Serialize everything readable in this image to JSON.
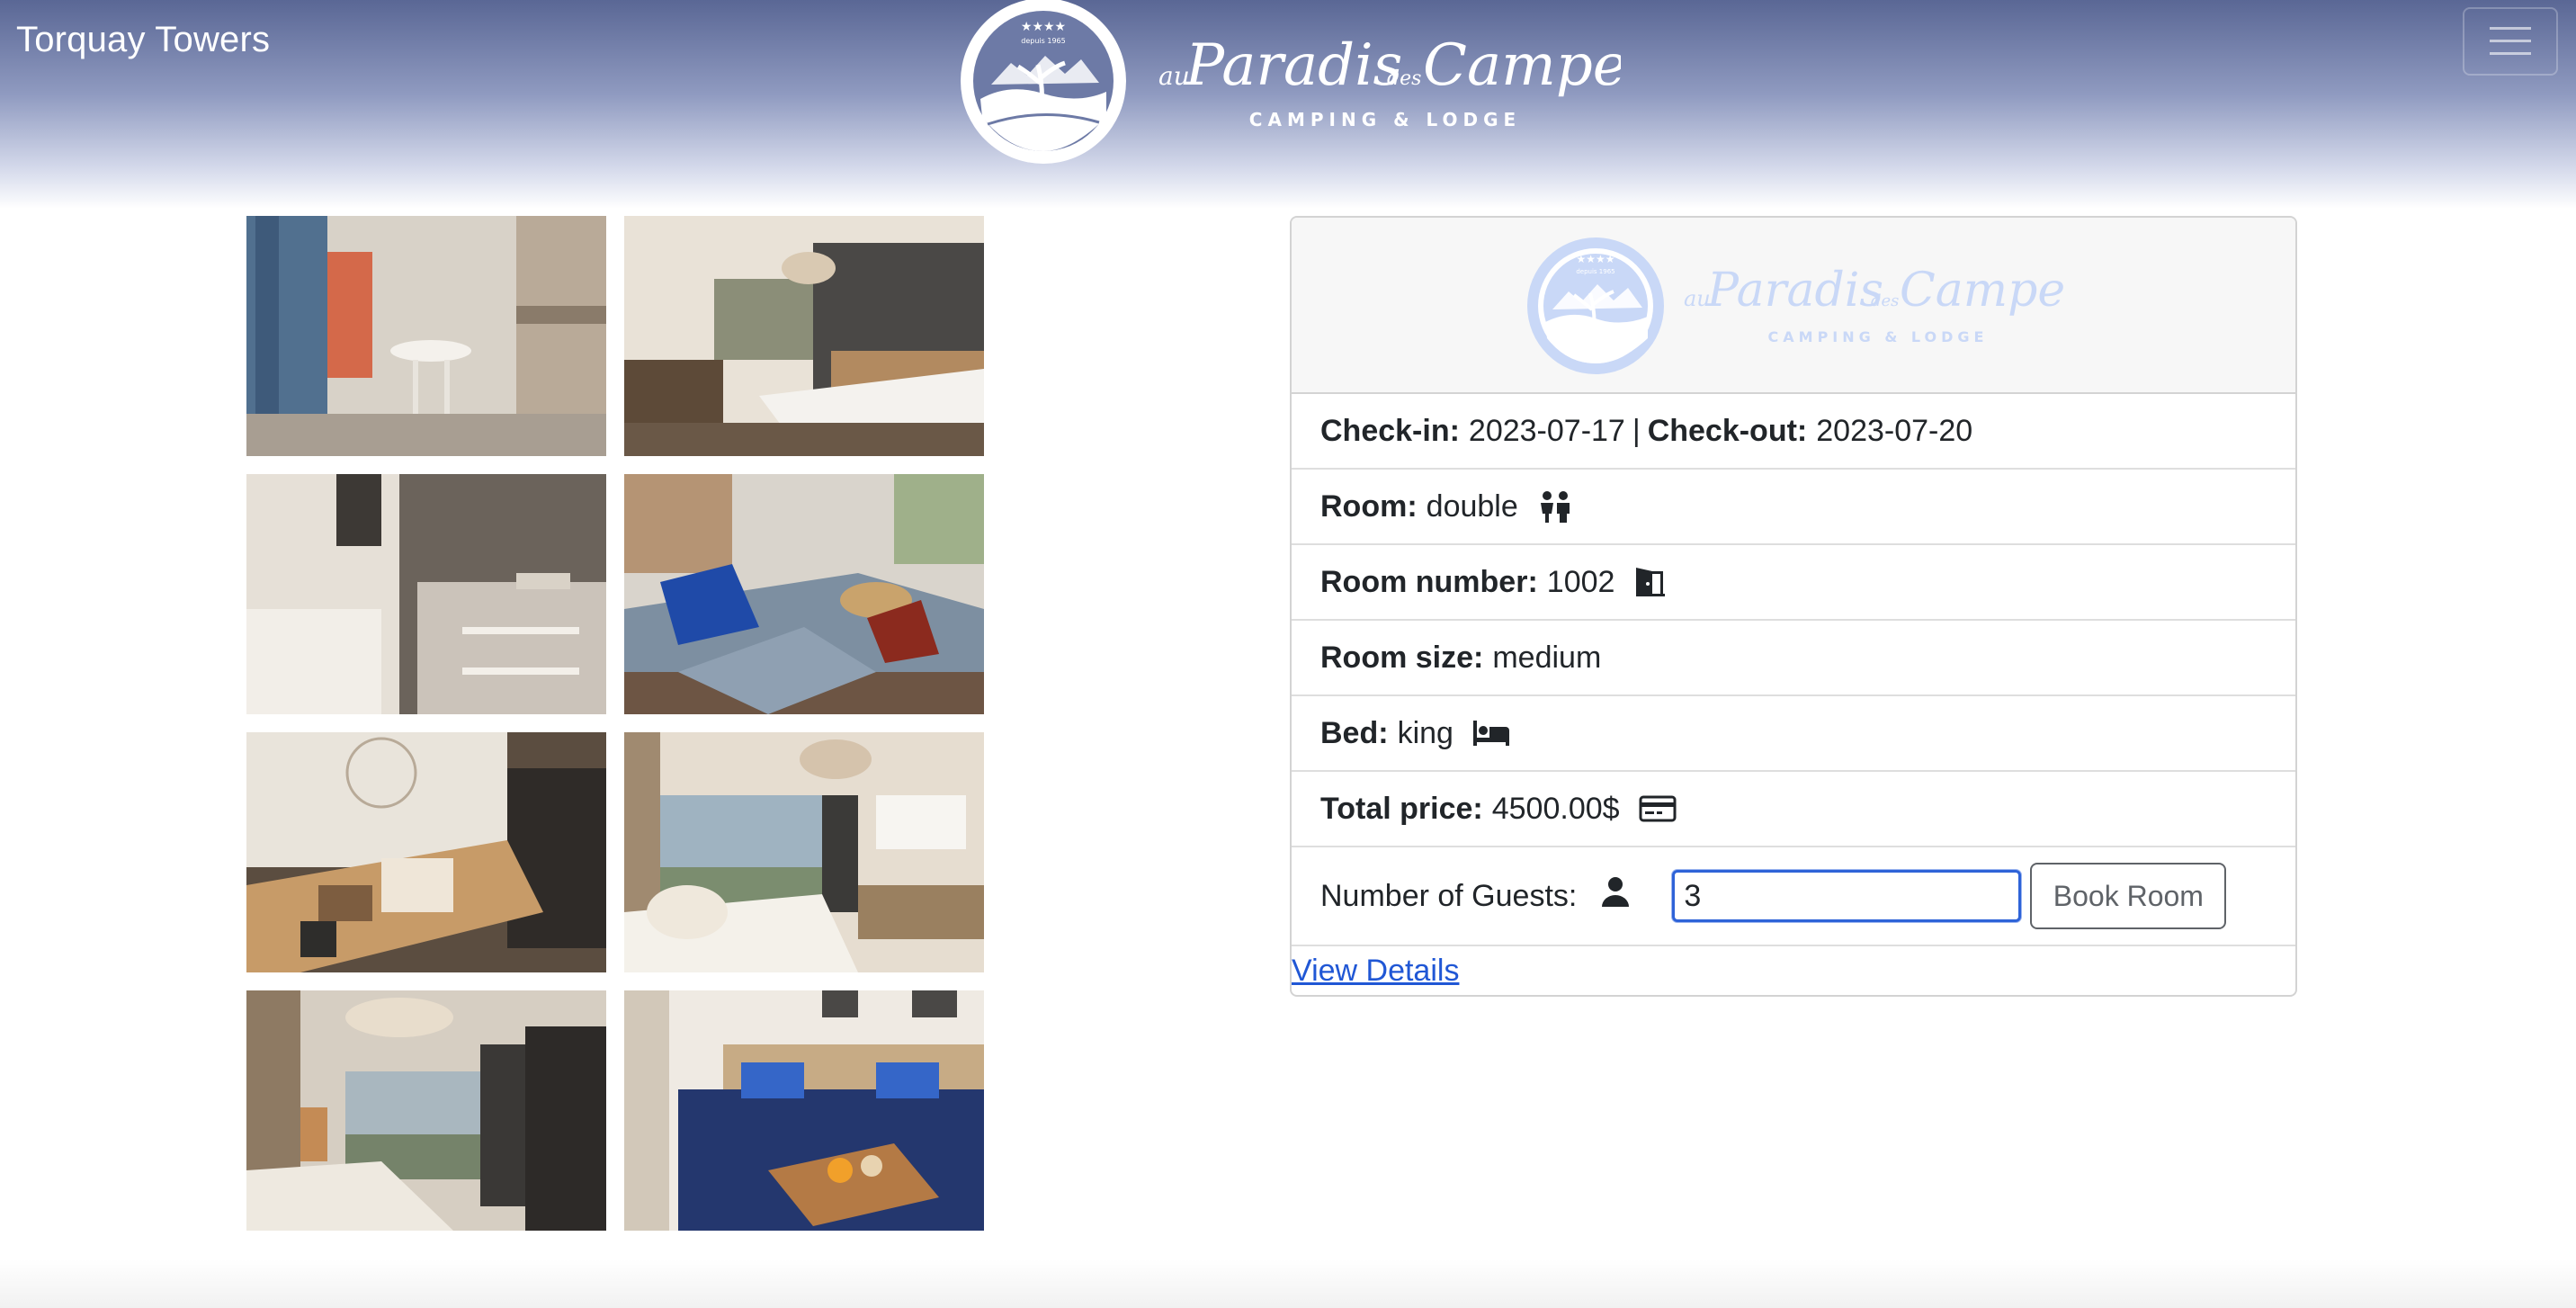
{
  "header": {
    "brand": "Torquay Towers",
    "logo": {
      "script_prefix": "au",
      "script_main": "Paradis",
      "script_small": "des",
      "script_end": "Campeurs",
      "tagline": "CAMPING & LODGE",
      "stars": "★★★★",
      "since": "depuis 1965"
    },
    "menu_icon": "hamburger-icon"
  },
  "gallery": {
    "photos": [
      {
        "alt": "room-photo-1"
      },
      {
        "alt": "room-photo-2"
      },
      {
        "alt": "room-photo-3"
      },
      {
        "alt": "room-photo-4"
      },
      {
        "alt": "room-photo-5"
      },
      {
        "alt": "room-photo-6"
      },
      {
        "alt": "room-photo-7"
      },
      {
        "alt": "room-photo-8"
      }
    ]
  },
  "card": {
    "checkin_label": "Check-in:",
    "checkin_value": "2023-07-17",
    "separator": "|",
    "checkout_label": "Check-out:",
    "checkout_value": "2023-07-20",
    "room_label": "Room:",
    "room_value": "double",
    "room_icon": "people-icon",
    "room_number_label": "Room number:",
    "room_number_value": "1002",
    "room_number_icon": "door-icon",
    "room_size_label": "Room size:",
    "room_size_value": "medium",
    "bed_label": "Bed:",
    "bed_value": "king",
    "bed_icon": "bed-icon",
    "price_label": "Total price:",
    "price_value": "4500.00$",
    "price_icon": "credit-card-icon",
    "guests_label": "Number of Guests:",
    "guests_icon": "person-icon",
    "guests_value": "3",
    "book_button": "Book Room",
    "details_link": "View Details"
  },
  "colors": {
    "header_top": "#5a6795",
    "link": "#2057d5",
    "focus_border": "#2e63d8"
  }
}
